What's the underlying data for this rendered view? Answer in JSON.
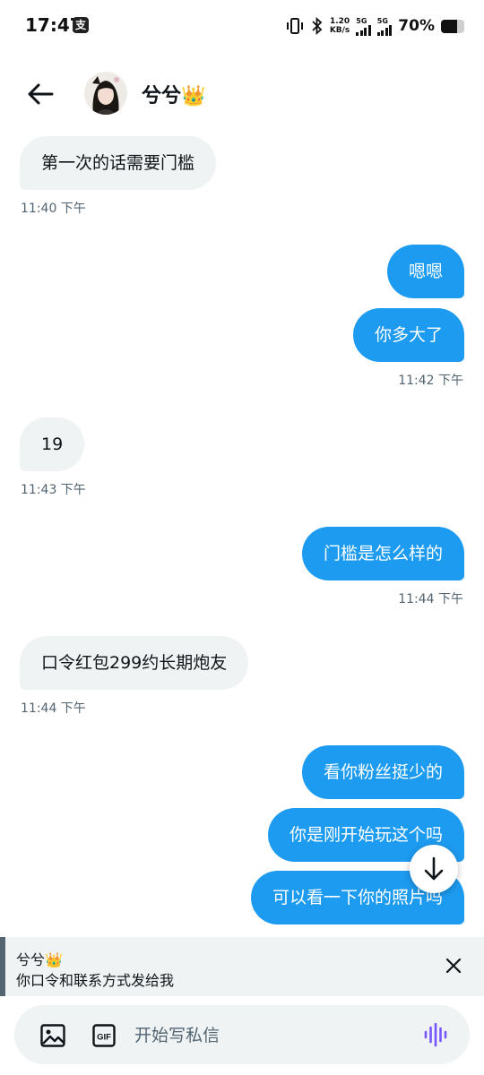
{
  "status_bar": {
    "time": "17:47",
    "app_badge": "支",
    "net_speed_value": "1.20",
    "net_speed_unit": "KB/s",
    "sim1_label": "5G",
    "sim2_label": "5G",
    "battery_percent": "70%",
    "battery_level": 0.7
  },
  "header": {
    "contact_name": "兮兮👑"
  },
  "messages": [
    {
      "direction": "in",
      "text": "第一次的话需要门槛"
    },
    {
      "direction": "in",
      "timestamp": "11:40 下午"
    },
    {
      "direction": "out",
      "text": "嗯嗯"
    },
    {
      "direction": "out",
      "text": "你多大了"
    },
    {
      "direction": "out",
      "timestamp": "11:42 下午"
    },
    {
      "direction": "in",
      "text": "19"
    },
    {
      "direction": "in",
      "timestamp": "11:43 下午"
    },
    {
      "direction": "out",
      "text": "门槛是怎么样的"
    },
    {
      "direction": "out",
      "timestamp": "11:44 下午"
    },
    {
      "direction": "in",
      "text": "口令红包299约长期炮友"
    },
    {
      "direction": "in",
      "timestamp": "11:44 下午"
    },
    {
      "direction": "out",
      "text": "看你粉丝挺少的"
    },
    {
      "direction": "out",
      "text": "你是刚开始玩这个吗"
    },
    {
      "direction": "out",
      "text": "可以看一下你的照片吗"
    }
  ],
  "reply_preview": {
    "name": "兮兮👑",
    "text": "你口令和联系方式发给我"
  },
  "composer": {
    "placeholder": "开始写私信",
    "gif_label": "GIF"
  },
  "colors": {
    "outgoing_bubble": "#1d9bf0",
    "incoming_bubble": "#eff3f4",
    "voice_icon": "#7856ff"
  }
}
